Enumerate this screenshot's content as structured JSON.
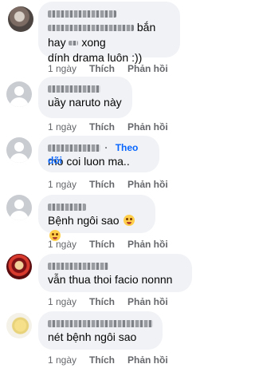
{
  "comments": [
    {
      "avatar": "photo-cat-avatar",
      "avatar_color": "#7b6b63",
      "text_suffix": "bắn hay",
      "text_suffix2": "xong",
      "text_line2": "dính drama luôn :))",
      "time": "1 ngày",
      "like": "Thích",
      "reply": "Phản hồi"
    },
    {
      "avatar": "default-avatar",
      "text_line1": "uầy naruto này",
      "time": "1 ngày",
      "like": "Thích",
      "reply": "Phản hồi"
    },
    {
      "avatar": "default-avatar",
      "follow": "Theo dõi",
      "text_line1": "mo coi luon ma..",
      "time": "1 ngày",
      "like": "Thích",
      "reply": "Phản hồi"
    },
    {
      "avatar": "default-avatar",
      "text_line1": "Bệnh ngôi sao",
      "emojis": [
        "laughing-emoji",
        "laughing-emoji"
      ],
      "time": "1 ngày",
      "like": "Thích",
      "reply": "Phản hồi"
    },
    {
      "avatar": "red-character-avatar",
      "avatar_color": "#b7262b",
      "text_line1": "vẫn thua thoi facio nonnn",
      "time": "1 ngày",
      "like": "Thích",
      "reply": "Phản hồi"
    },
    {
      "avatar": "bird-avatar",
      "avatar_color": "#efe6a8",
      "text_line1": "nét bệnh ngôi sao",
      "time": "1 ngày",
      "like": "Thích",
      "reply": "Phản hồi"
    }
  ]
}
